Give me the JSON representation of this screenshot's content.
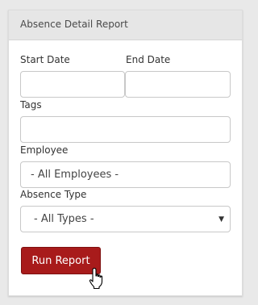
{
  "panel": {
    "title": "Absence Detail Report"
  },
  "form": {
    "start_date_label": "Start Date",
    "start_date_value": "",
    "end_date_label": "End Date",
    "end_date_value": "",
    "tags_label": "Tags",
    "tags_value": "",
    "employee_label": "Employee",
    "employee_selected": "- All Employees -",
    "absence_type_label": "Absence Type",
    "absence_type_selected": "- All Types -",
    "run_label": "Run Report"
  },
  "icons": {
    "dropdown": "chevron-down-icon",
    "cursor": "hand-pointer-icon"
  },
  "colors": {
    "primary_button": "#a81b1b"
  }
}
